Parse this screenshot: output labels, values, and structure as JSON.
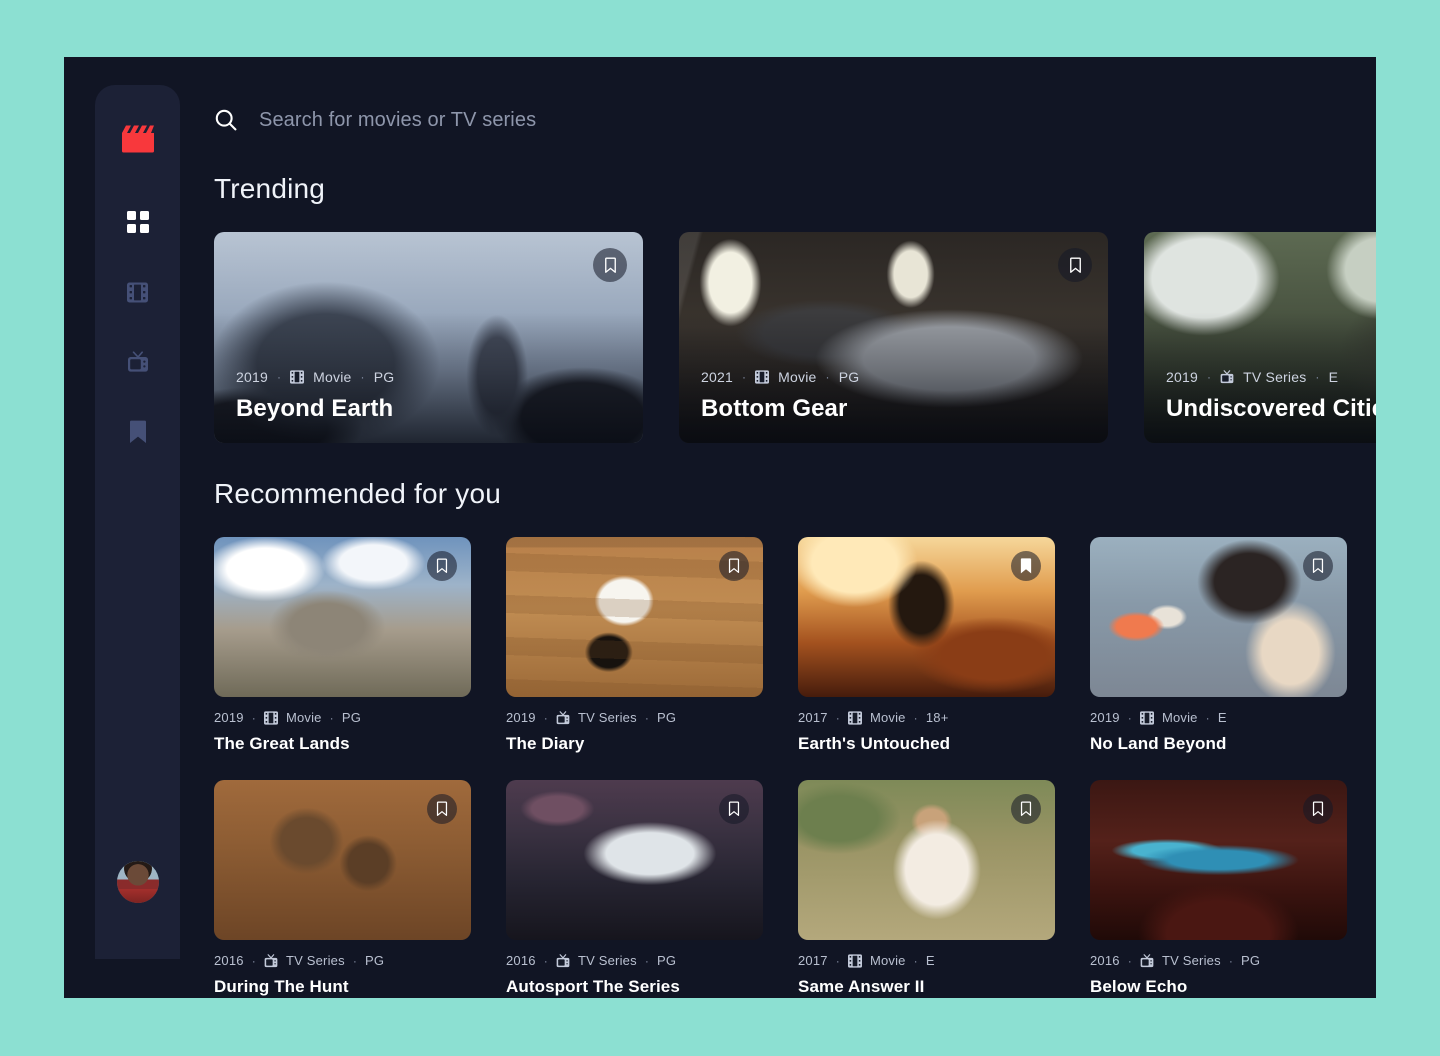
{
  "brand": {
    "logo_icon": "clapperboard-icon",
    "logo_color": "#f8383c"
  },
  "colors": {
    "page_background": "#8ce0d2",
    "app_background": "#111524",
    "sidebar_background": "#1c2136",
    "accent": "#f8383c",
    "active_nav": "#ffffff",
    "inactive_nav": "#455077"
  },
  "sidebar": {
    "items": [
      {
        "icon": "grid-icon",
        "name": "dashboard",
        "active": true
      },
      {
        "icon": "film-strip-icon",
        "name": "movies",
        "active": false
      },
      {
        "icon": "tv-icon",
        "name": "tv-series",
        "active": false
      },
      {
        "icon": "bookmark-icon",
        "name": "bookmarks",
        "active": false
      }
    ],
    "avatar": {
      "name": "user-avatar"
    }
  },
  "search": {
    "icon": "search-icon",
    "placeholder": "Search for movies or TV series",
    "value": ""
  },
  "sections": {
    "trending": {
      "title": "Trending"
    },
    "recommended": {
      "title": "Recommended for you"
    }
  },
  "trending": [
    {
      "year": "2019",
      "type": "Movie",
      "type_icon": "film-strip-icon",
      "rating": "PG",
      "title": "Beyond Earth",
      "bookmarked": false,
      "art": "art-beyond-earth"
    },
    {
      "year": "2021",
      "type": "Movie",
      "type_icon": "film-strip-icon",
      "rating": "PG",
      "title": "Bottom Gear",
      "bookmarked": false,
      "art": "art-bottom-gear"
    },
    {
      "year": "2019",
      "type": "TV Series",
      "type_icon": "tv-icon",
      "rating": "E",
      "title": "Undiscovered Cities",
      "bookmarked": false,
      "art": "art-undiscovered"
    }
  ],
  "recommended": [
    {
      "year": "2019",
      "type": "Movie",
      "type_icon": "film-strip-icon",
      "rating": "PG",
      "title": "The Great Lands",
      "bookmarked": false,
      "art": "art-great-lands"
    },
    {
      "year": "2019",
      "type": "TV Series",
      "type_icon": "tv-icon",
      "rating": "PG",
      "title": "The Diary",
      "bookmarked": false,
      "art": "art-diary"
    },
    {
      "year": "2017",
      "type": "Movie",
      "type_icon": "film-strip-icon",
      "rating": "18+",
      "title": "Earth's Untouched",
      "bookmarked": true,
      "art": "art-earths-untouched"
    },
    {
      "year": "2019",
      "type": "Movie",
      "type_icon": "film-strip-icon",
      "rating": "E",
      "title": "No Land Beyond",
      "bookmarked": false,
      "art": "art-no-land-beyond"
    },
    {
      "year": "2016",
      "type": "TV Series",
      "type_icon": "tv-icon",
      "rating": "PG",
      "title": "During The Hunt",
      "bookmarked": false,
      "art": "art-during-the-hunt"
    },
    {
      "year": "2016",
      "type": "TV Series",
      "type_icon": "tv-icon",
      "rating": "PG",
      "title": "Autosport The Series",
      "bookmarked": false,
      "art": "art-autosport"
    },
    {
      "year": "2017",
      "type": "Movie",
      "type_icon": "film-strip-icon",
      "rating": "E",
      "title": "Same Answer II",
      "bookmarked": false,
      "art": "art-same-answer"
    },
    {
      "year": "2016",
      "type": "TV Series",
      "type_icon": "tv-icon",
      "rating": "PG",
      "title": "Below Echo",
      "bookmarked": false,
      "art": "art-below-echo"
    }
  ],
  "separator": "·"
}
